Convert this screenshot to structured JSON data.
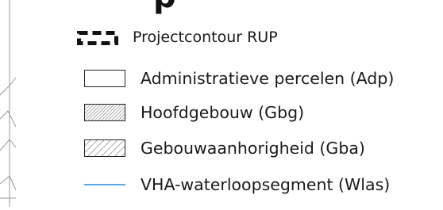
{
  "legend": {
    "heading": "p",
    "items": [
      {
        "label": "Projectcontour RUP",
        "symbol": "black dashed outline"
      },
      {
        "label": "Administratieve percelen (Adp)",
        "symbol": "white box with black outline"
      },
      {
        "label": "Hoofdgebouw (Gbg)",
        "symbol": "dense diagonal hatch"
      },
      {
        "label": "Gebouwaanhorigheid (Gba)",
        "symbol": "sparse diagonal hatch"
      },
      {
        "label": "VHA-waterloopsegment (Wlas)",
        "symbol": "light blue line"
      }
    ]
  },
  "colors": {
    "water_line": "#5aa9e6",
    "outline": "#222222",
    "hatch": "#333333"
  }
}
